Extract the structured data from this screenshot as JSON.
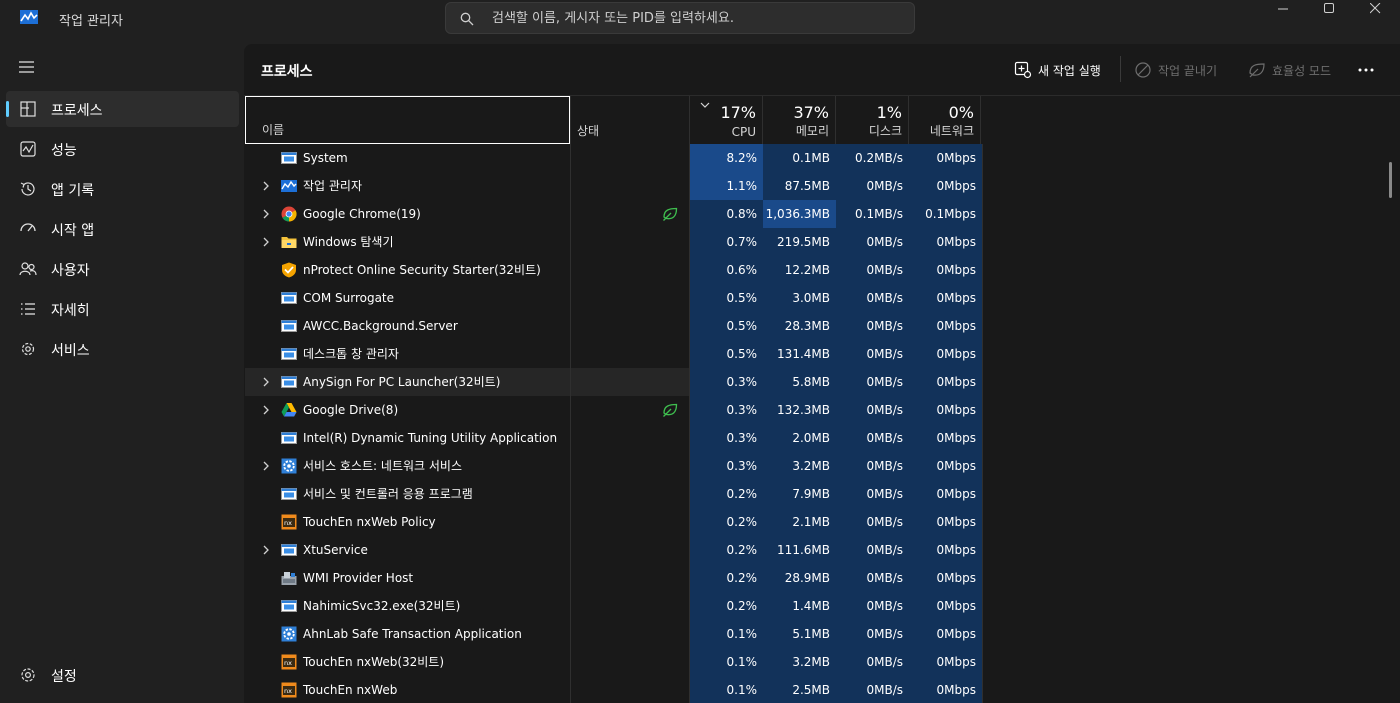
{
  "app": {
    "title": "작업 관리자"
  },
  "search": {
    "placeholder": "검색할 이름, 게시자 또는 PID를 입력하세요."
  },
  "sidebar": {
    "items": [
      {
        "label": "프로세스",
        "icon": "processes-icon",
        "active": true
      },
      {
        "label": "성능",
        "icon": "performance-icon"
      },
      {
        "label": "앱 기록",
        "icon": "app-history-icon"
      },
      {
        "label": "시작 앱",
        "icon": "startup-icon"
      },
      {
        "label": "사용자",
        "icon": "users-icon"
      },
      {
        "label": "자세히",
        "icon": "details-icon"
      },
      {
        "label": "서비스",
        "icon": "services-icon"
      }
    ],
    "settings_label": "설정"
  },
  "main": {
    "title": "프로세스",
    "toolbar": {
      "run_new_task": "새 작업 실행",
      "end_task": "작업 끝내기",
      "efficiency_mode": "효율성 모드"
    }
  },
  "table": {
    "headers": {
      "name": "이름",
      "status": "상태",
      "cpu_pct": "17%",
      "cpu": "CPU",
      "mem_pct": "37%",
      "mem": "메모리",
      "disk_pct": "1%",
      "disk": "디스크",
      "net_pct": "0%",
      "net": "네트워크"
    },
    "rows": [
      {
        "name": "System",
        "expand": false,
        "icon": "window-icon",
        "eco": false,
        "cpu": "8.2%",
        "mem": "0.1MB",
        "disk": "0.2MB/s",
        "net": "0Mbps"
      },
      {
        "name": "작업 관리자",
        "expand": true,
        "icon": "taskmgr-icon",
        "eco": false,
        "cpu": "1.1%",
        "mem": "87.5MB",
        "disk": "0MB/s",
        "net": "0Mbps"
      },
      {
        "name": "Google Chrome(19)",
        "expand": true,
        "icon": "chrome-icon",
        "eco": true,
        "cpu": "0.8%",
        "mem": "1,036.3MB",
        "disk": "0.1MB/s",
        "net": "0.1Mbps"
      },
      {
        "name": "Windows 탐색기",
        "expand": true,
        "icon": "folder-icon",
        "eco": false,
        "cpu": "0.7%",
        "mem": "219.5MB",
        "disk": "0MB/s",
        "net": "0Mbps"
      },
      {
        "name": "nProtect Online Security Starter(32비트)",
        "expand": false,
        "icon": "shield-icon",
        "eco": false,
        "cpu": "0.6%",
        "mem": "12.2MB",
        "disk": "0MB/s",
        "net": "0Mbps"
      },
      {
        "name": "COM Surrogate",
        "expand": false,
        "icon": "window-icon",
        "eco": false,
        "cpu": "0.5%",
        "mem": "3.0MB",
        "disk": "0MB/s",
        "net": "0Mbps"
      },
      {
        "name": "AWCC.Background.Server",
        "expand": false,
        "icon": "window-icon",
        "eco": false,
        "cpu": "0.5%",
        "mem": "28.3MB",
        "disk": "0MB/s",
        "net": "0Mbps"
      },
      {
        "name": "데스크톱 창 관리자",
        "expand": false,
        "icon": "window-icon",
        "eco": false,
        "cpu": "0.5%",
        "mem": "131.4MB",
        "disk": "0MB/s",
        "net": "0Mbps"
      },
      {
        "name": "AnySign For PC Launcher(32비트)",
        "expand": true,
        "icon": "window-icon",
        "eco": false,
        "cpu": "0.3%",
        "mem": "5.8MB",
        "disk": "0MB/s",
        "net": "0Mbps",
        "hl": true
      },
      {
        "name": "Google Drive(8)",
        "expand": true,
        "icon": "drive-icon",
        "eco": true,
        "cpu": "0.3%",
        "mem": "132.3MB",
        "disk": "0MB/s",
        "net": "0Mbps"
      },
      {
        "name": "Intel(R) Dynamic Tuning Utility Application",
        "expand": false,
        "icon": "window-icon",
        "eco": false,
        "cpu": "0.3%",
        "mem": "2.0MB",
        "disk": "0MB/s",
        "net": "0Mbps"
      },
      {
        "name": "서비스 호스트: 네트워크 서비스",
        "expand": true,
        "icon": "gear-icon",
        "eco": false,
        "cpu": "0.3%",
        "mem": "3.2MB",
        "disk": "0MB/s",
        "net": "0Mbps"
      },
      {
        "name": "서비스 및 컨트롤러 응용 프로그램",
        "expand": false,
        "icon": "window-icon",
        "eco": false,
        "cpu": "0.2%",
        "mem": "7.9MB",
        "disk": "0MB/s",
        "net": "0Mbps"
      },
      {
        "name": "TouchEn nxWeb  Policy",
        "expand": false,
        "icon": "touchen-icon",
        "eco": false,
        "cpu": "0.2%",
        "mem": "2.1MB",
        "disk": "0MB/s",
        "net": "0Mbps"
      },
      {
        "name": "XtuService",
        "expand": true,
        "icon": "window-icon",
        "eco": false,
        "cpu": "0.2%",
        "mem": "111.6MB",
        "disk": "0MB/s",
        "net": "0Mbps"
      },
      {
        "name": "WMI Provider Host",
        "expand": false,
        "icon": "wmi-icon",
        "eco": false,
        "cpu": "0.2%",
        "mem": "28.9MB",
        "disk": "0MB/s",
        "net": "0Mbps"
      },
      {
        "name": "NahimicSvc32.exe(32비트)",
        "expand": false,
        "icon": "window-icon",
        "eco": false,
        "cpu": "0.2%",
        "mem": "1.4MB",
        "disk": "0MB/s",
        "net": "0Mbps"
      },
      {
        "name": "AhnLab Safe Transaction Application",
        "expand": false,
        "icon": "gear-icon",
        "eco": false,
        "cpu": "0.1%",
        "mem": "5.1MB",
        "disk": "0MB/s",
        "net": "0Mbps"
      },
      {
        "name": "TouchEn nxWeb(32비트)",
        "expand": false,
        "icon": "touchen-icon",
        "eco": false,
        "cpu": "0.1%",
        "mem": "3.2MB",
        "disk": "0MB/s",
        "net": "0Mbps"
      },
      {
        "name": "TouchEn nxWeb",
        "expand": false,
        "icon": "touchen-icon",
        "eco": false,
        "cpu": "0.1%",
        "mem": "2.5MB",
        "disk": "0MB/s",
        "net": "0Mbps"
      }
    ]
  }
}
